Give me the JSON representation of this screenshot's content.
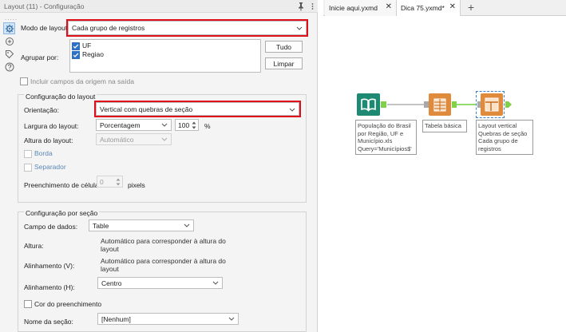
{
  "window": {
    "title": "Layout (11) - Configuração",
    "pin_icon": "pin-icon",
    "menu_icon": "panel-menu-icon",
    "grip": "....."
  },
  "side_toolbar": [
    {
      "name": "config-icon"
    },
    {
      "name": "connections-icon"
    },
    {
      "name": "annotation-tag-icon"
    },
    {
      "name": "help-icon"
    }
  ],
  "layout_mode": {
    "label": "Modo de layout:",
    "value": "Cada grupo de registros"
  },
  "group_by": {
    "label": "Agrupar por:",
    "items": [
      {
        "label": "UF",
        "checked": true
      },
      {
        "label": "Regiao",
        "checked": true
      }
    ],
    "all_button": "Tudo",
    "clear_button": "Limpar"
  },
  "include_source": {
    "label": "Incluir campos da origem na saída",
    "checked": false
  },
  "layout_config": {
    "title": "Configuração do layout",
    "orientation_label": "Orientação:",
    "orientation_value": "Vertical com quebras de seção",
    "width_label": "Largura do layout:",
    "width_unit": "Porcentagem",
    "width_value": "100",
    "width_suffix": "%",
    "height_label": "Altura do layout:",
    "height_value": "Automático",
    "border_label": "Borda",
    "separator_label": "Separador",
    "cell_fill_label": "Preenchimento de célula:",
    "cell_fill_value": "0",
    "cell_fill_unit": "pixels"
  },
  "section_config": {
    "title": "Configuração por seção",
    "data_field_label": "Campo de dados:",
    "data_field_value": "Table",
    "height_label": "Altura:",
    "height_value": "Automático para corresponder à altura do layout",
    "align_v_label": "Alinhamento (V):",
    "align_v_value": "Automático para corresponder à altura do layout",
    "align_h_label": "Alinhamento (H):",
    "align_h_value": "Centro",
    "fill_color_label": "Cor do preenchimento",
    "section_name_label": "Nome da seção:",
    "section_name_value": "[Nenhum]"
  },
  "tabs": [
    {
      "label": "Inicie aqui.yxmd",
      "close": "✕"
    },
    {
      "label": "Dica 75.yxmd*",
      "close": "✕"
    }
  ],
  "add_tab": "+",
  "workflow": {
    "input_node": {
      "icon": "book-input-icon",
      "color": "#1f8a74",
      "label": "População do Brasil por Região, UF e Município.xls Query='Municípios$'"
    },
    "table_node": {
      "icon": "table-tool-icon",
      "color": "#e08a3c",
      "label": "Tabela básica"
    },
    "layout_node": {
      "icon": "layout-tool-icon",
      "color": "#e08a3c",
      "label": "Layout vertical Quebras de seção Cada grupo de registros"
    },
    "connector_color": "#7fd14a"
  }
}
